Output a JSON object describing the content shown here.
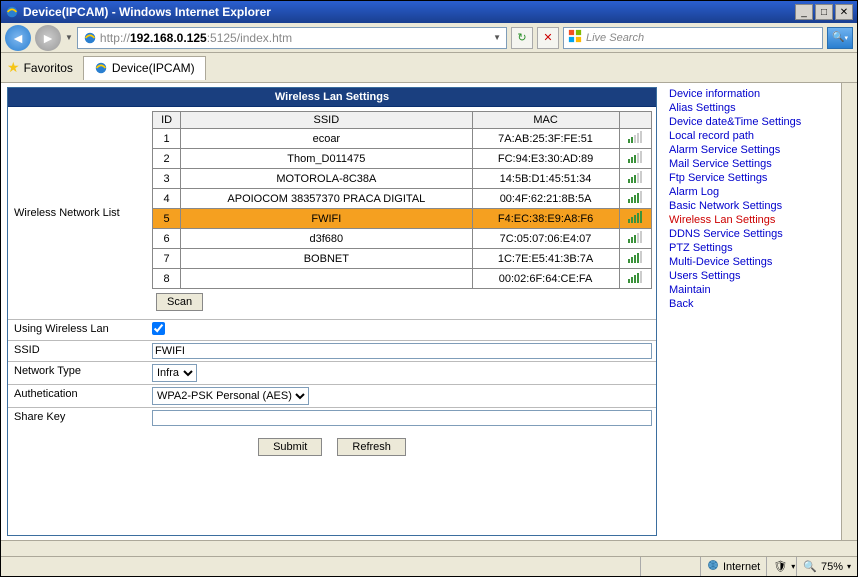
{
  "window": {
    "title": "Device(IPCAM) - Windows Internet Explorer"
  },
  "url": {
    "grey_prefix": "http://",
    "host": "192.168.0.125",
    "grey_suffix": ":5125/index.htm"
  },
  "search": {
    "placeholder": "Live Search"
  },
  "favorites_label": "Favoritos",
  "tab_title": "Device(IPCAM)",
  "section_title": "Wireless Lan Settings",
  "wlist_label": "Wireless Network List",
  "columns": {
    "id": "ID",
    "ssid": "SSID",
    "mac": "MAC"
  },
  "networks": [
    {
      "id": "1",
      "ssid": "ecoar",
      "mac": "7A:AB:25:3F:FE:51",
      "bars": 2,
      "selected": false
    },
    {
      "id": "2",
      "ssid": "Thom_D011475",
      "mac": "FC:94:E3:30:AD:89",
      "bars": 3,
      "selected": false
    },
    {
      "id": "3",
      "ssid": "MOTOROLA-8C38A",
      "mac": "14:5B:D1:45:51:34",
      "bars": 3,
      "selected": false
    },
    {
      "id": "4",
      "ssid": "APOIOCOM 38357370 PRACA DIGITAL",
      "mac": "00:4F:62:21:8B:5A",
      "bars": 4,
      "selected": false
    },
    {
      "id": "5",
      "ssid": "FWIFI",
      "mac": "F4:EC:38:E9:A8:F6",
      "bars": 5,
      "selected": true
    },
    {
      "id": "6",
      "ssid": "d3f680",
      "mac": "7C:05:07:06:E4:07",
      "bars": 3,
      "selected": false
    },
    {
      "id": "7",
      "ssid": "BOBNET",
      "mac": "1C:7E:E5:41:3B:7A",
      "bars": 4,
      "selected": false
    },
    {
      "id": "8",
      "ssid": "",
      "mac": "00:02:6F:64:CE:FA",
      "bars": 4,
      "selected": false
    }
  ],
  "scan_label": "Scan",
  "form": {
    "using_label": "Using Wireless Lan",
    "ssid_label": "SSID",
    "ssid_value": "FWIFI",
    "nettype_label": "Network Type",
    "nettype_value": "Infra",
    "auth_label": "Authetication",
    "auth_value": "WPA2-PSK Personal (AES)",
    "sharekey_label": "Share Key",
    "sharekey_value": ""
  },
  "buttons": {
    "submit": "Submit",
    "refresh": "Refresh"
  },
  "menu": [
    {
      "label": "Device information",
      "active": false
    },
    {
      "label": "Alias Settings",
      "active": false
    },
    {
      "label": "Device date&Time Settings",
      "active": false
    },
    {
      "label": "Local record path",
      "active": false
    },
    {
      "label": "Alarm Service Settings",
      "active": false
    },
    {
      "label": "Mail Service Settings",
      "active": false
    },
    {
      "label": "Ftp Service Settings",
      "active": false
    },
    {
      "label": "Alarm Log",
      "active": false
    },
    {
      "label": "Basic Network Settings",
      "active": false
    },
    {
      "label": "Wireless Lan Settings",
      "active": true
    },
    {
      "label": "DDNS Service Settings",
      "active": false
    },
    {
      "label": "PTZ Settings",
      "active": false
    },
    {
      "label": "Multi-Device Settings",
      "active": false
    },
    {
      "label": "Users Settings",
      "active": false
    },
    {
      "label": "Maintain",
      "active": false
    },
    {
      "label": "Back",
      "active": false
    }
  ],
  "status": {
    "zone": "Internet",
    "zoom": "75%"
  }
}
